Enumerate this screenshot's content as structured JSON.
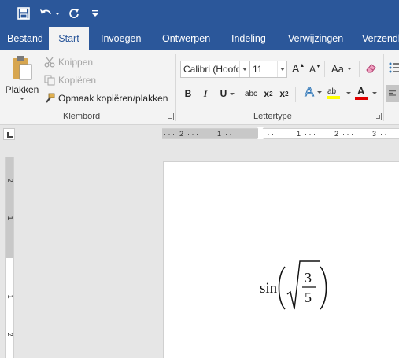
{
  "quick_access": {
    "icons": [
      "save-icon",
      "undo-icon",
      "redo-icon",
      "customize-qat-icon"
    ]
  },
  "tabs": [
    {
      "label": "Bestand"
    },
    {
      "label": "Start"
    },
    {
      "label": "Invoegen"
    },
    {
      "label": "Ontwerpen"
    },
    {
      "label": "Indeling"
    },
    {
      "label": "Verwijzingen"
    },
    {
      "label": "Verzendlij"
    }
  ],
  "active_tab": "Start",
  "ribbon": {
    "clipboard": {
      "paste_label": "Plakken",
      "cut_label": "Knippen",
      "copy_label": "Kopiëren",
      "format_painter_label": "Opmaak kopiëren/plakken",
      "group_label": "Klembord"
    },
    "font": {
      "font_name": "Calibri (Hoofd",
      "font_size": "11",
      "grow_label": "A",
      "shrink_label": "A",
      "case_label": "Aa",
      "bold_label": "B",
      "italic_label": "I",
      "underline_label": "U",
      "strike_label": "abc",
      "subscript_label": "x",
      "subscript_mark": "2",
      "superscript_label": "x",
      "superscript_mark": "2",
      "highlight_label": "ab",
      "color_label": "A",
      "group_label": "Lettertype",
      "highlight_color": "#ffff00",
      "font_color": "#e00000"
    }
  },
  "ruler": {
    "h_labels": [
      "2",
      "1",
      "1",
      "2",
      "3"
    ],
    "v_labels": [
      "2",
      "1",
      "1",
      "2"
    ]
  },
  "document": {
    "equation": {
      "function": "sin",
      "numerator": "3",
      "denominator": "5"
    }
  },
  "colors": {
    "accent": "#2b579a",
    "ribbon_bg": "#f3f3f3",
    "workspace_bg": "#e6e6e6"
  }
}
